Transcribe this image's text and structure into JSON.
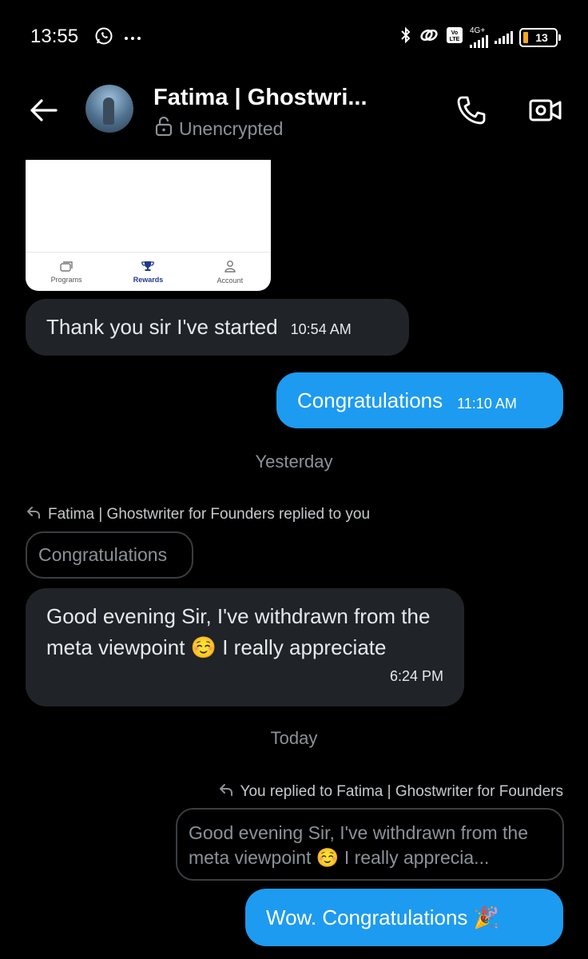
{
  "status_bar": {
    "time": "13:55",
    "network": "4G+",
    "volte": "Vo LTE",
    "battery": "13"
  },
  "header": {
    "contact_name": "Fatima | Ghostwri...",
    "encryption_status": "Unencrypted"
  },
  "attachment": {
    "nav_items": [
      "Programs",
      "Rewards",
      "Account"
    ],
    "active_index": 1
  },
  "messages": [
    {
      "direction": "incoming",
      "text": "Thank you sir I've started",
      "time": "10:54 AM"
    },
    {
      "direction": "outgoing",
      "text": "Congratulations",
      "time": "11:10 AM"
    },
    {
      "direction": "incoming",
      "reply_label": "Fatima | Ghostwriter for Founders replied to you",
      "quote": "Congratulations",
      "text": "Good evening Sir, I've withdrawn from the meta viewpoint ☺️ I really appreciate",
      "time": "6:24 PM"
    },
    {
      "direction": "outgoing",
      "reply_label": "You replied to Fatima | Ghostwriter for Founders",
      "quote": "Good evening Sir, I've withdrawn from the meta viewpoint ☺️ I really apprecia...",
      "text": "Wow. Congratulations 🎉"
    }
  ],
  "dividers": [
    "Yesterday",
    "Today"
  ],
  "colors": {
    "outgoing_bubble": "#1d9bf0",
    "incoming_bubble": "#202327",
    "background": "#000000"
  }
}
